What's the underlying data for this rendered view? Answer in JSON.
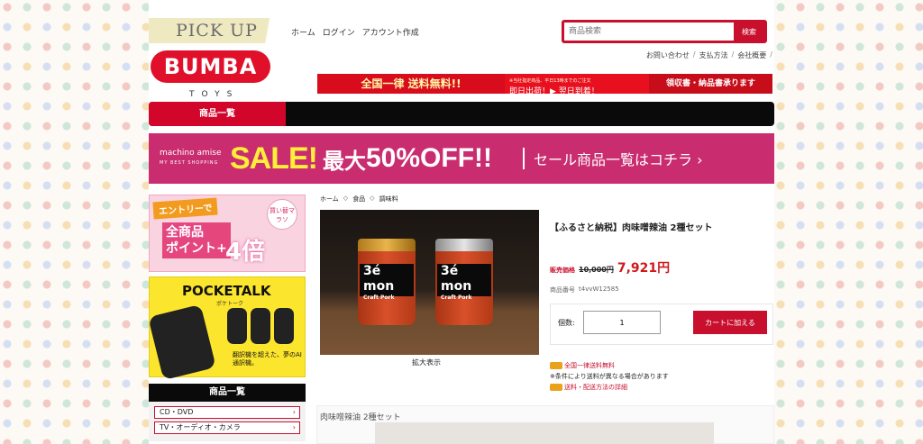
{
  "header": {
    "pickup": "PICK UP",
    "logo_text": "BUMBA",
    "logo_sub": "TOYS",
    "nav": [
      "ホーム",
      "ログイン",
      "アカウント作成"
    ],
    "search_placeholder": "商品検索",
    "search_button": "検索",
    "util_links": [
      "お問い合わせ",
      "支払方法",
      "会社概要"
    ],
    "banner_free_shipping": "全国一律 送料無料!!",
    "banner_sameday": "即日出荷！▶ 翌日到着！",
    "banner_sameday_note": "※当社指定商品、平日13時までのご注文",
    "banner_receipt": "領収書・納品書承ります"
  },
  "category_bar": {
    "tab": "商品一覧"
  },
  "sale_banner": {
    "brand": "machino amise",
    "brand_sub": "MY BEST SHOPPING",
    "sale": "SALE!",
    "max": "最大",
    "off": "50%OFF!!",
    "link": "セール商品一覧はコチラ ›"
  },
  "sidebar": {
    "entry_tag": "エントリーで",
    "entry_badge": "買い替マラソ",
    "entry_text_1": "全商品",
    "entry_text_2": "ポイント+",
    "entry_multiplier": "4倍",
    "pocketalk_title": "POCKETALK",
    "pocketalk_sub": "ポケトーク",
    "pocketalk_note": "翻訳機を超えた、夢のAI通訳機。",
    "category_head": "商品一覧",
    "categories": [
      "CD・DVD",
      "TV・オーディオ・カメラ"
    ]
  },
  "breadcrumb": [
    "ホーム",
    "食品",
    "調味料"
  ],
  "breadcrumb_sep": "◇",
  "product": {
    "jar_label": "3é mon",
    "jar_sub": "Craft Pork",
    "zoom": "拡大表示",
    "name": "【ふるさと納税】肉味噌辣油 2種セット",
    "price_label": "販売価格",
    "old_price": "10,000円",
    "price": "7,921円",
    "code_label": "商品番号",
    "code": "t4vvW12585",
    "qty_label": "個数:",
    "qty": "1",
    "cart_button": "カートに加える",
    "shipping_1": "全国一律送料無料",
    "shipping_2": "※条件により送料が異なる場合があります",
    "shipping_3": "送料・配送方法の詳細"
  },
  "lower": {
    "title": "肉味噌辣油 2種セット"
  }
}
